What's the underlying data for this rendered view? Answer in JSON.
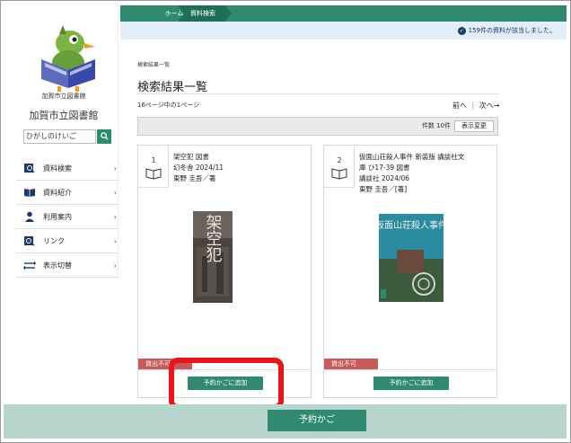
{
  "breadcrumb": {
    "home": "ホーム",
    "current": "資料検索"
  },
  "notice": {
    "text": "159件の資料が該当しました。"
  },
  "sidebar": {
    "logo_text": "加賀市立図書館",
    "library_name": "加賀市立図書館",
    "search_value": "ひがしのけいご",
    "items": [
      {
        "label": "資料検索",
        "icon": "search-book-icon"
      },
      {
        "label": "資料紹介",
        "icon": "open-book-icon"
      },
      {
        "label": "利用案内",
        "icon": "person-icon"
      },
      {
        "label": "リンク",
        "icon": "link-icon"
      },
      {
        "label": "表示切替",
        "icon": "swap-arrows-icon"
      }
    ]
  },
  "main": {
    "small_crumb": "検索結果一覧",
    "title": "検索結果一覧",
    "page_info": "16ページ中の1ページ",
    "prev": "前へ",
    "next": "次へ→",
    "count_label": "件数 10件",
    "display_change": "表示変更"
  },
  "results": [
    {
      "num": "1",
      "lines": [
        "架空犯 図書",
        "幻冬舎 2024/11",
        "東野 圭吾／著"
      ],
      "cover_title": "架空犯",
      "status": "貸出不可",
      "reserve": "予約かごに追加"
    },
    {
      "num": "2",
      "lines": [
        "仮面山荘殺人事件 新装版 講談社文",
        "庫 ひ17-39 図書",
        "講談社 2024/06",
        "東野 圭吾／[著]"
      ],
      "cover_title": "仮面山荘殺人事件",
      "status": "貸出不可",
      "reserve": "予約かごに追加"
    }
  ],
  "bottom": {
    "cart": "予約かご"
  },
  "colors": {
    "accent": "#2f8a6f",
    "status": "#c85a5a",
    "highlight": "#e8141a"
  }
}
